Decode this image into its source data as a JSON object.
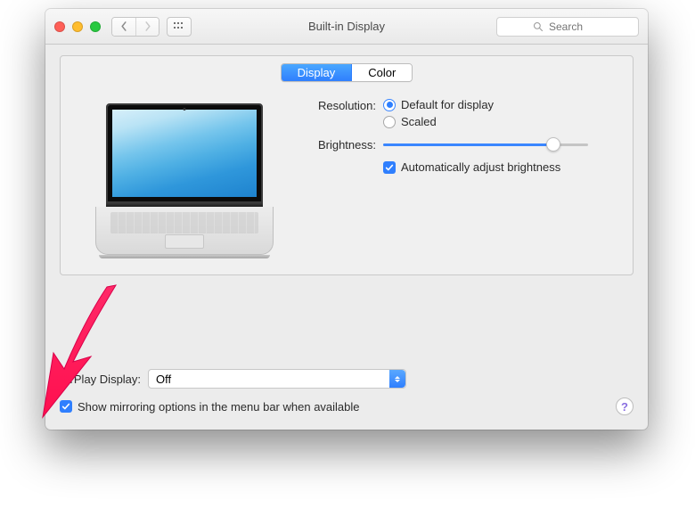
{
  "window": {
    "title": "Built-in Display"
  },
  "toolbar": {
    "search_placeholder": "Search"
  },
  "tabs": {
    "display": "Display",
    "color": "Color",
    "selected": "Display"
  },
  "resolution": {
    "label": "Resolution:",
    "options": {
      "default": "Default for display",
      "scaled": "Scaled"
    },
    "selected": "default"
  },
  "brightness": {
    "label": "Brightness:",
    "value_pct": 83,
    "auto_label": "Automatically adjust brightness",
    "auto_checked": true
  },
  "airplay": {
    "label": "AirPlay Display:",
    "value": "Off"
  },
  "mirroring": {
    "label": "Show mirroring options in the menu bar when available",
    "checked": true
  },
  "annotation": {
    "color": "#ff2a68"
  }
}
